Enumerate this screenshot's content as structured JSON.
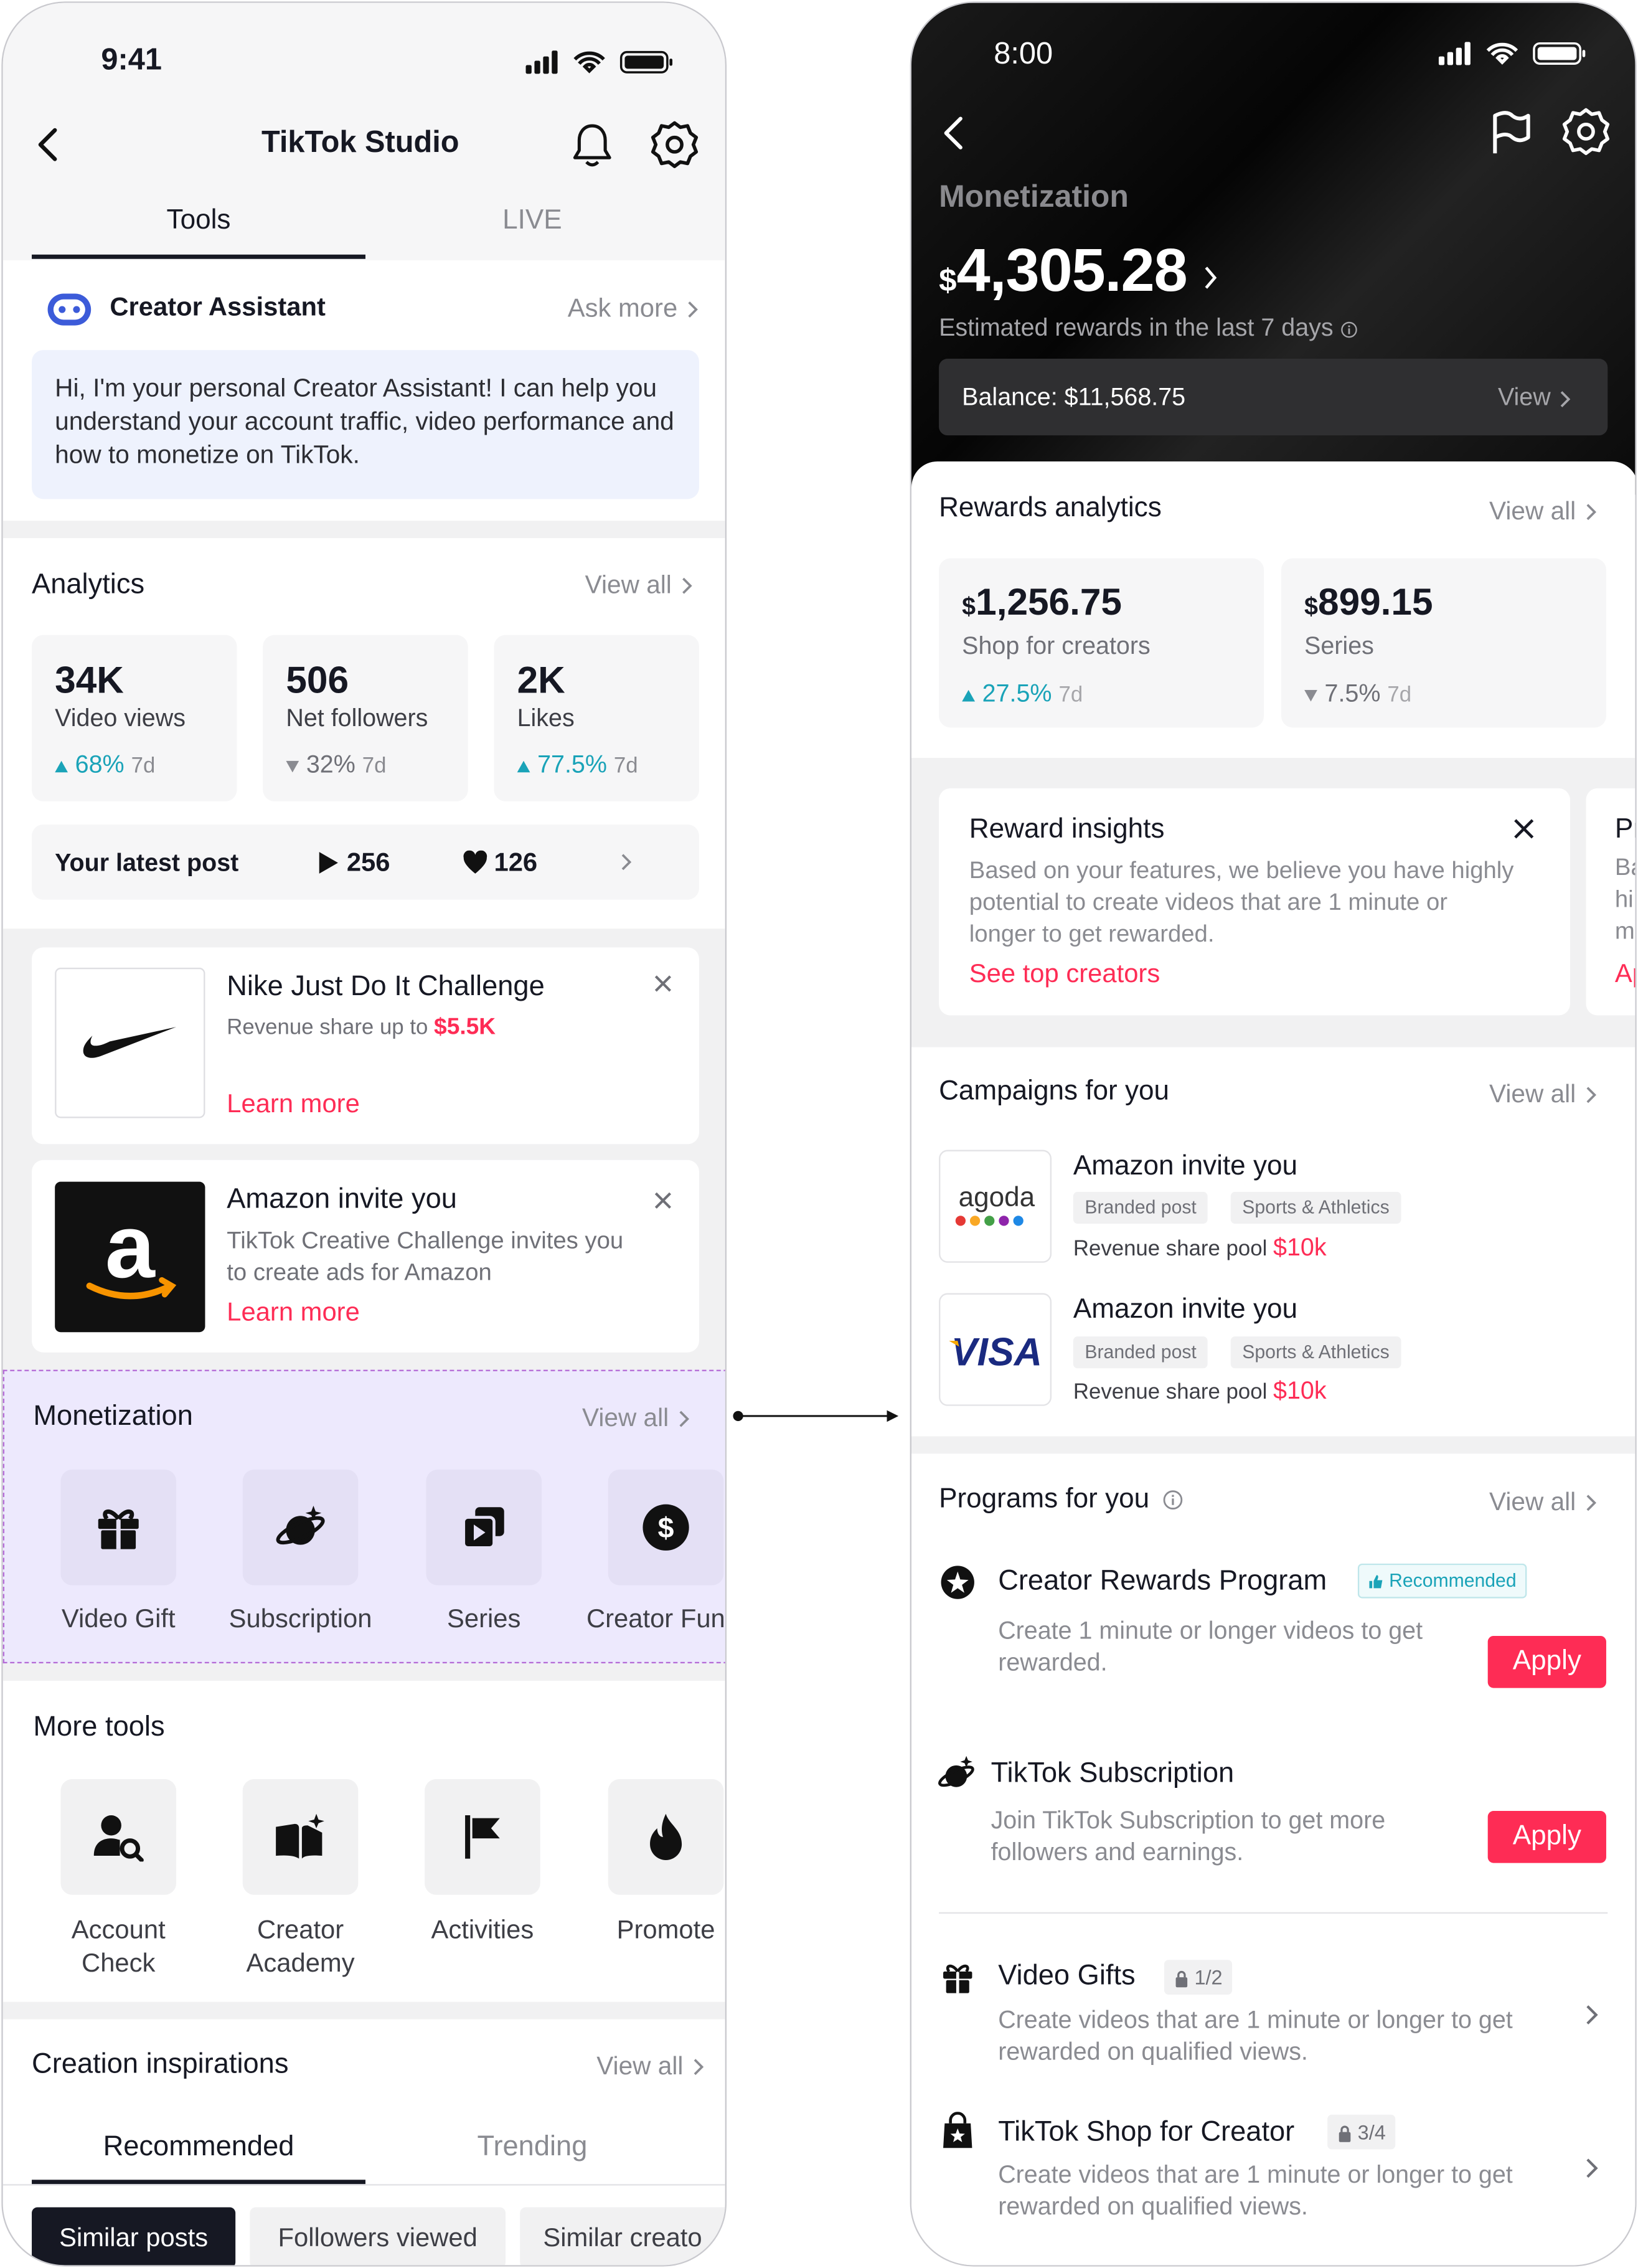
{
  "left": {
    "status_time": "9:41",
    "title": "TikTok Studio",
    "tabs": [
      "Tools",
      "LIVE"
    ],
    "assistant": {
      "title": "Creator Assistant",
      "ask_more": "Ask more",
      "message": "Hi, I'm your personal Creator Assistant! I can help you understand your account traffic, video performance and how to monetize on TikTok."
    },
    "analytics": {
      "title": "Analytics",
      "view_all": "View all",
      "stats": [
        {
          "value": "34K",
          "label": "Video views",
          "change": "68%",
          "dir": "up",
          "period": "7d"
        },
        {
          "value": "506",
          "label": "Net followers",
          "change": "32%",
          "dir": "down",
          "period": "7d"
        },
        {
          "value": "2K",
          "label": "Likes",
          "change": "77.5%",
          "dir": "up",
          "period": "7d"
        }
      ],
      "latest": {
        "label": "Your latest post",
        "plays": "256",
        "likes": "126"
      }
    },
    "promos": [
      {
        "title": "Nike Just Do It Challenge",
        "desc": "Revenue share up to ",
        "amount": "$5.5K",
        "cta": "Learn more"
      },
      {
        "title": "Amazon invite you",
        "desc": "TikTok Creative Challenge invites you to create ads for Amazon",
        "cta": "Learn more"
      }
    ],
    "monetization": {
      "title": "Monetization",
      "view_all": "View all",
      "items": [
        "Video Gift",
        "Subscription",
        "Series",
        "Creator Fun"
      ]
    },
    "more_tools": {
      "title": "More tools",
      "items": [
        "Account\nCheck",
        "Creator\nAcademy",
        "Activities",
        "Promote"
      ]
    },
    "inspirations": {
      "title": "Creation inspirations",
      "view_all": "View all",
      "tabs": [
        "Recommended",
        "Trending"
      ],
      "chips": [
        "Similar posts",
        "Followers viewed",
        "Similar creato"
      ]
    }
  },
  "right": {
    "status_time": "8:00",
    "title": "Monetization",
    "amount_symbol": "$",
    "amount": "4,305.28",
    "subtitle": "Estimated rewards in the last 7 days",
    "balance": "Balance: $11,568.75",
    "balance_view": "View",
    "rewards": {
      "title": "Rewards analytics",
      "view_all": "View all",
      "cards": [
        {
          "symbol": "$",
          "value": "1,256.75",
          "label": "Shop for creators",
          "change": "27.5%",
          "dir": "up",
          "period": "7d"
        },
        {
          "symbol": "$",
          "value": "899.15",
          "label": "Series",
          "change": "7.5%",
          "dir": "down",
          "period": "7d"
        }
      ]
    },
    "insight": {
      "title": "Reward insights",
      "text": "Based on your features, we believe you have highly potential to create videos that are 1 minute or longer to get rewarded.",
      "cta": "See top creators",
      "peek": [
        "Pr",
        "Ba",
        "hi",
        "m",
        "Ap"
      ]
    },
    "campaigns": {
      "title": "Campaigns for you",
      "view_all": "View all",
      "items": [
        {
          "brand": "agoda",
          "title": "Amazon invite you",
          "tags": [
            "Branded post",
            "Sports & Athletics"
          ],
          "pool_label": "Revenue share pool ",
          "pool": "$10k"
        },
        {
          "brand": "VISA",
          "title": "Amazon invite you",
          "tags": [
            "Branded post",
            "Sports & Athletics"
          ],
          "pool_label": "Revenue share pool ",
          "pool": "$10k"
        }
      ]
    },
    "programs": {
      "title": "Programs for you",
      "view_all": "View all",
      "items": [
        {
          "title": "Creator Rewards Program",
          "badge": "Recommended",
          "desc": "Create 1 minute or longer videos to get rewarded.",
          "action": "Apply"
        },
        {
          "title": "TikTok Subscription",
          "desc": "Join TikTok Subscription to get more followers and earnings.",
          "action": "Apply"
        },
        {
          "title": "Video Gifts",
          "progress": "1/2",
          "desc": "Create videos that are 1 minute or longer to get rewarded on qualified views."
        },
        {
          "title": "TikTok Shop for Creator",
          "progress": "3/4",
          "desc": "Create videos that are 1 minute or longer to get rewarded on qualified views."
        }
      ]
    }
  },
  "colors": {
    "accent": "#fe2c55",
    "teal": "#1aa3b8",
    "highlight": "#ede9fd",
    "highlight_border": "#b46ad6"
  }
}
